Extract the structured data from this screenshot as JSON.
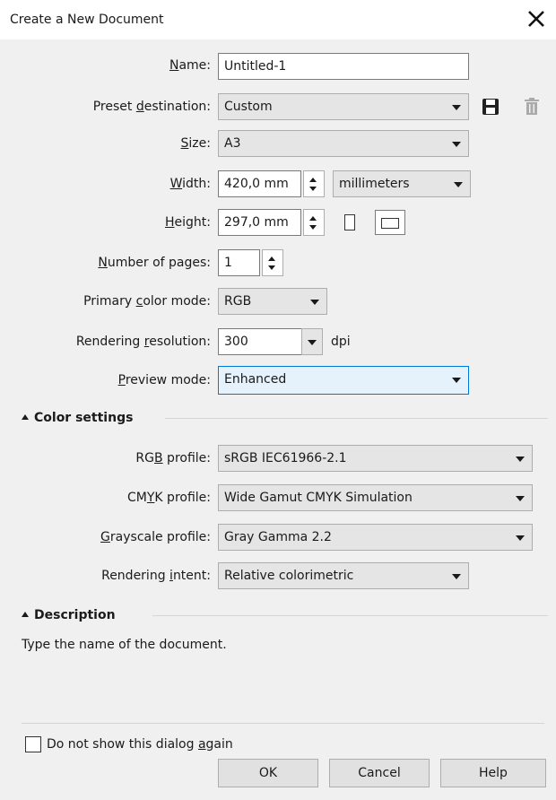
{
  "dialog": {
    "title": "Create a New Document",
    "close_icon": "close-icon"
  },
  "fields": {
    "name": {
      "label_pre": "",
      "label_u": "N",
      "label_post": "ame:",
      "value": "Untitled-1"
    },
    "preset": {
      "label_pre": "Preset ",
      "label_u": "d",
      "label_post": "estination:",
      "value": "Custom",
      "save_icon": "save-icon",
      "delete_icon": "trash-icon"
    },
    "size": {
      "label_pre": "",
      "label_u": "S",
      "label_post": "ize:",
      "value": "A3"
    },
    "width": {
      "label_pre": "",
      "label_u": "W",
      "label_post": "idth:",
      "value": "420,0 mm",
      "units": "millimeters"
    },
    "height": {
      "label_pre": "",
      "label_u": "H",
      "label_post": "eight:",
      "value": "297,0 mm",
      "portrait_icon": "portrait-icon",
      "landscape_icon": "landscape-icon"
    },
    "pages": {
      "label_pre": "",
      "label_u": "N",
      "label_post": "umber of pages:",
      "value": "1"
    },
    "color_mode": {
      "label_pre": "Primary ",
      "label_u": "c",
      "label_post": "olor mode:",
      "value": "RGB"
    },
    "resolution": {
      "label_pre": "Rendering ",
      "label_u": "r",
      "label_post": "esolution:",
      "value": "300",
      "unit": "dpi"
    },
    "preview": {
      "label_pre": "",
      "label_u": "P",
      "label_post": "review mode:",
      "value": "Enhanced"
    }
  },
  "color_settings": {
    "heading": "Color settings",
    "rgb": {
      "label_pre": "RG",
      "label_u": "B",
      "label_post": " profile:",
      "value": "sRGB IEC61966-2.1"
    },
    "cmyk": {
      "label_pre": "CM",
      "label_u": "Y",
      "label_post": "K profile:",
      "value": "Wide Gamut CMYK Simulation"
    },
    "gray": {
      "label_pre": "",
      "label_u": "G",
      "label_post": "rayscale profile:",
      "value": "Gray Gamma 2.2"
    },
    "intent": {
      "label_pre": "Rendering ",
      "label_u": "i",
      "label_post": "ntent:",
      "value": "Relative colorimetric"
    }
  },
  "description": {
    "heading": "Description",
    "text": "Type the name of the document."
  },
  "footer": {
    "dont_show_pre": "Do not show this dialog ",
    "dont_show_u": "a",
    "dont_show_post": "gain",
    "ok": "OK",
    "cancel": "Cancel",
    "help": "Help"
  }
}
